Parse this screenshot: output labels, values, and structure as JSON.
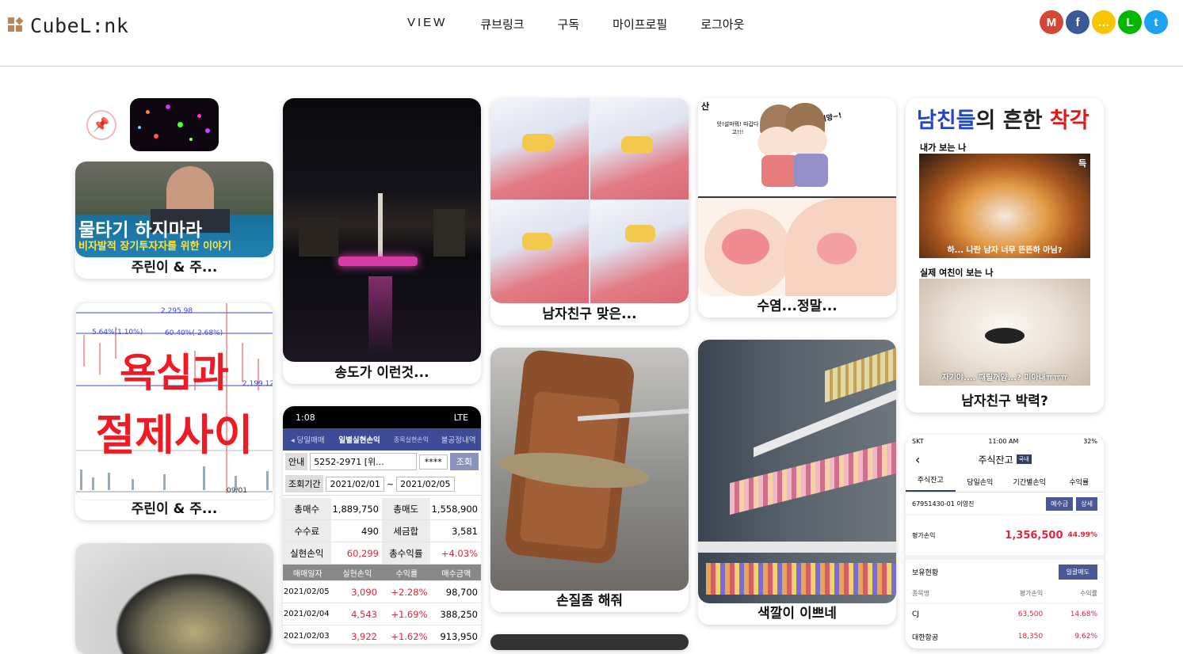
{
  "brand": {
    "name": "CubeL:nk"
  },
  "nav": [
    "VIEW",
    "큐브링크",
    "구독",
    "마이프로필",
    "로그아웃"
  ],
  "social": [
    {
      "name": "gmail",
      "glyph": "M",
      "color": "#d44638"
    },
    {
      "name": "facebook",
      "glyph": "f",
      "color": "#3b5998"
    },
    {
      "name": "kakaotalk",
      "glyph": "…",
      "color": "#f7c600"
    },
    {
      "name": "line",
      "glyph": "L",
      "color": "#00b900"
    },
    {
      "name": "twitter",
      "glyph": "t",
      "color": "#1da1f2"
    }
  ],
  "cards": {
    "c1": {
      "caption": "주린이 & 주...",
      "overlay1": "물타기 하지마라",
      "overlay2": "비자발적 장기투자자를 위한 이야기"
    },
    "c2": {
      "caption": "주린이 & 주...",
      "overlay1": "욕심과",
      "overlay2": "절제사이",
      "price_hi": "2,295.98",
      "price_lo": "2,199.12",
      "pct1": "5.64%(1.10%)",
      "pct2": "60.40%(-2.68%)",
      "date": "09/01"
    },
    "c3": {
      "caption": "송도가 이런것..."
    },
    "c4": {
      "caption": "남자친구 맞은..."
    },
    "c5": {
      "caption": "수염...정말...",
      "bubble1": "자기양~!",
      "bubble2": "앗!설마뭐! 따갑다고!!!",
      "corner": "산"
    },
    "c6": {
      "caption": "남자친구 박력?",
      "title_a": "남친들",
      "title_b": "의 흔한 ",
      "title_c": "착각",
      "sub1": "내가 보는 나",
      "line1": "하... 나란 남자 너무 뜬뜬하 아님?",
      "sub2": "실제 여친이 보는 나",
      "line2": "자기야.... 때릴꺼얌...? 미아내ㅠㅠㅠ",
      "mark": "득"
    },
    "c7": {
      "caption": "손질좀 해줘"
    },
    "c8": {
      "caption": "색깔이 이쁘네"
    },
    "c9": {
      "time": "1:08",
      "status": "LTE",
      "tabs": [
        "◂ 당일매매",
        "일별실현손익",
        "종목실현손익",
        "불공정내역"
      ],
      "acct_label": "안내",
      "acct": "5252-2971 [위...",
      "pw": "****",
      "query": "조회",
      "period_label": "조회기간",
      "from": "2021/02/01",
      "to": "2021/02/05",
      "sum": [
        [
          "총매수",
          "1,889,750",
          "총매도",
          "1,558,900"
        ],
        [
          "수수료",
          "490",
          "세금합",
          "3,581"
        ],
        [
          "실현손익",
          "60,299",
          "총수익률",
          "+4.03%"
        ]
      ],
      "head": [
        "매매일자",
        "실현손익",
        "수익률",
        "매수금액"
      ],
      "rows": [
        [
          "2021/02/05",
          "3,090",
          "+2.28%",
          "98,700"
        ],
        [
          "2021/02/04",
          "4,543",
          "+1.69%",
          "388,250"
        ],
        [
          "2021/02/03",
          "3,922",
          "+1.62%",
          "913,950"
        ]
      ]
    },
    "c10": {
      "carrier": "SKT",
      "time": "11:00 AM",
      "battery": "32%",
      "title": "주식잔고",
      "badge": "국내",
      "tabs": [
        "주식잔고",
        "당일손익",
        "기간별손익",
        "수익률"
      ],
      "account": "67951430-01 이영진",
      "btn1": "예수금",
      "btn2": "상세",
      "pl_label": "평가손익",
      "pl": "1,356,500",
      "pl_pct": "44.99%",
      "hold": "보유현황",
      "sell": "일괄매도",
      "head": [
        "종목명",
        "평가손익",
        "수익률"
      ],
      "rows": [
        [
          "CJ",
          "63,500",
          "14.68%"
        ],
        [
          "대한항공",
          "18,350",
          "9.62%"
        ]
      ]
    }
  }
}
